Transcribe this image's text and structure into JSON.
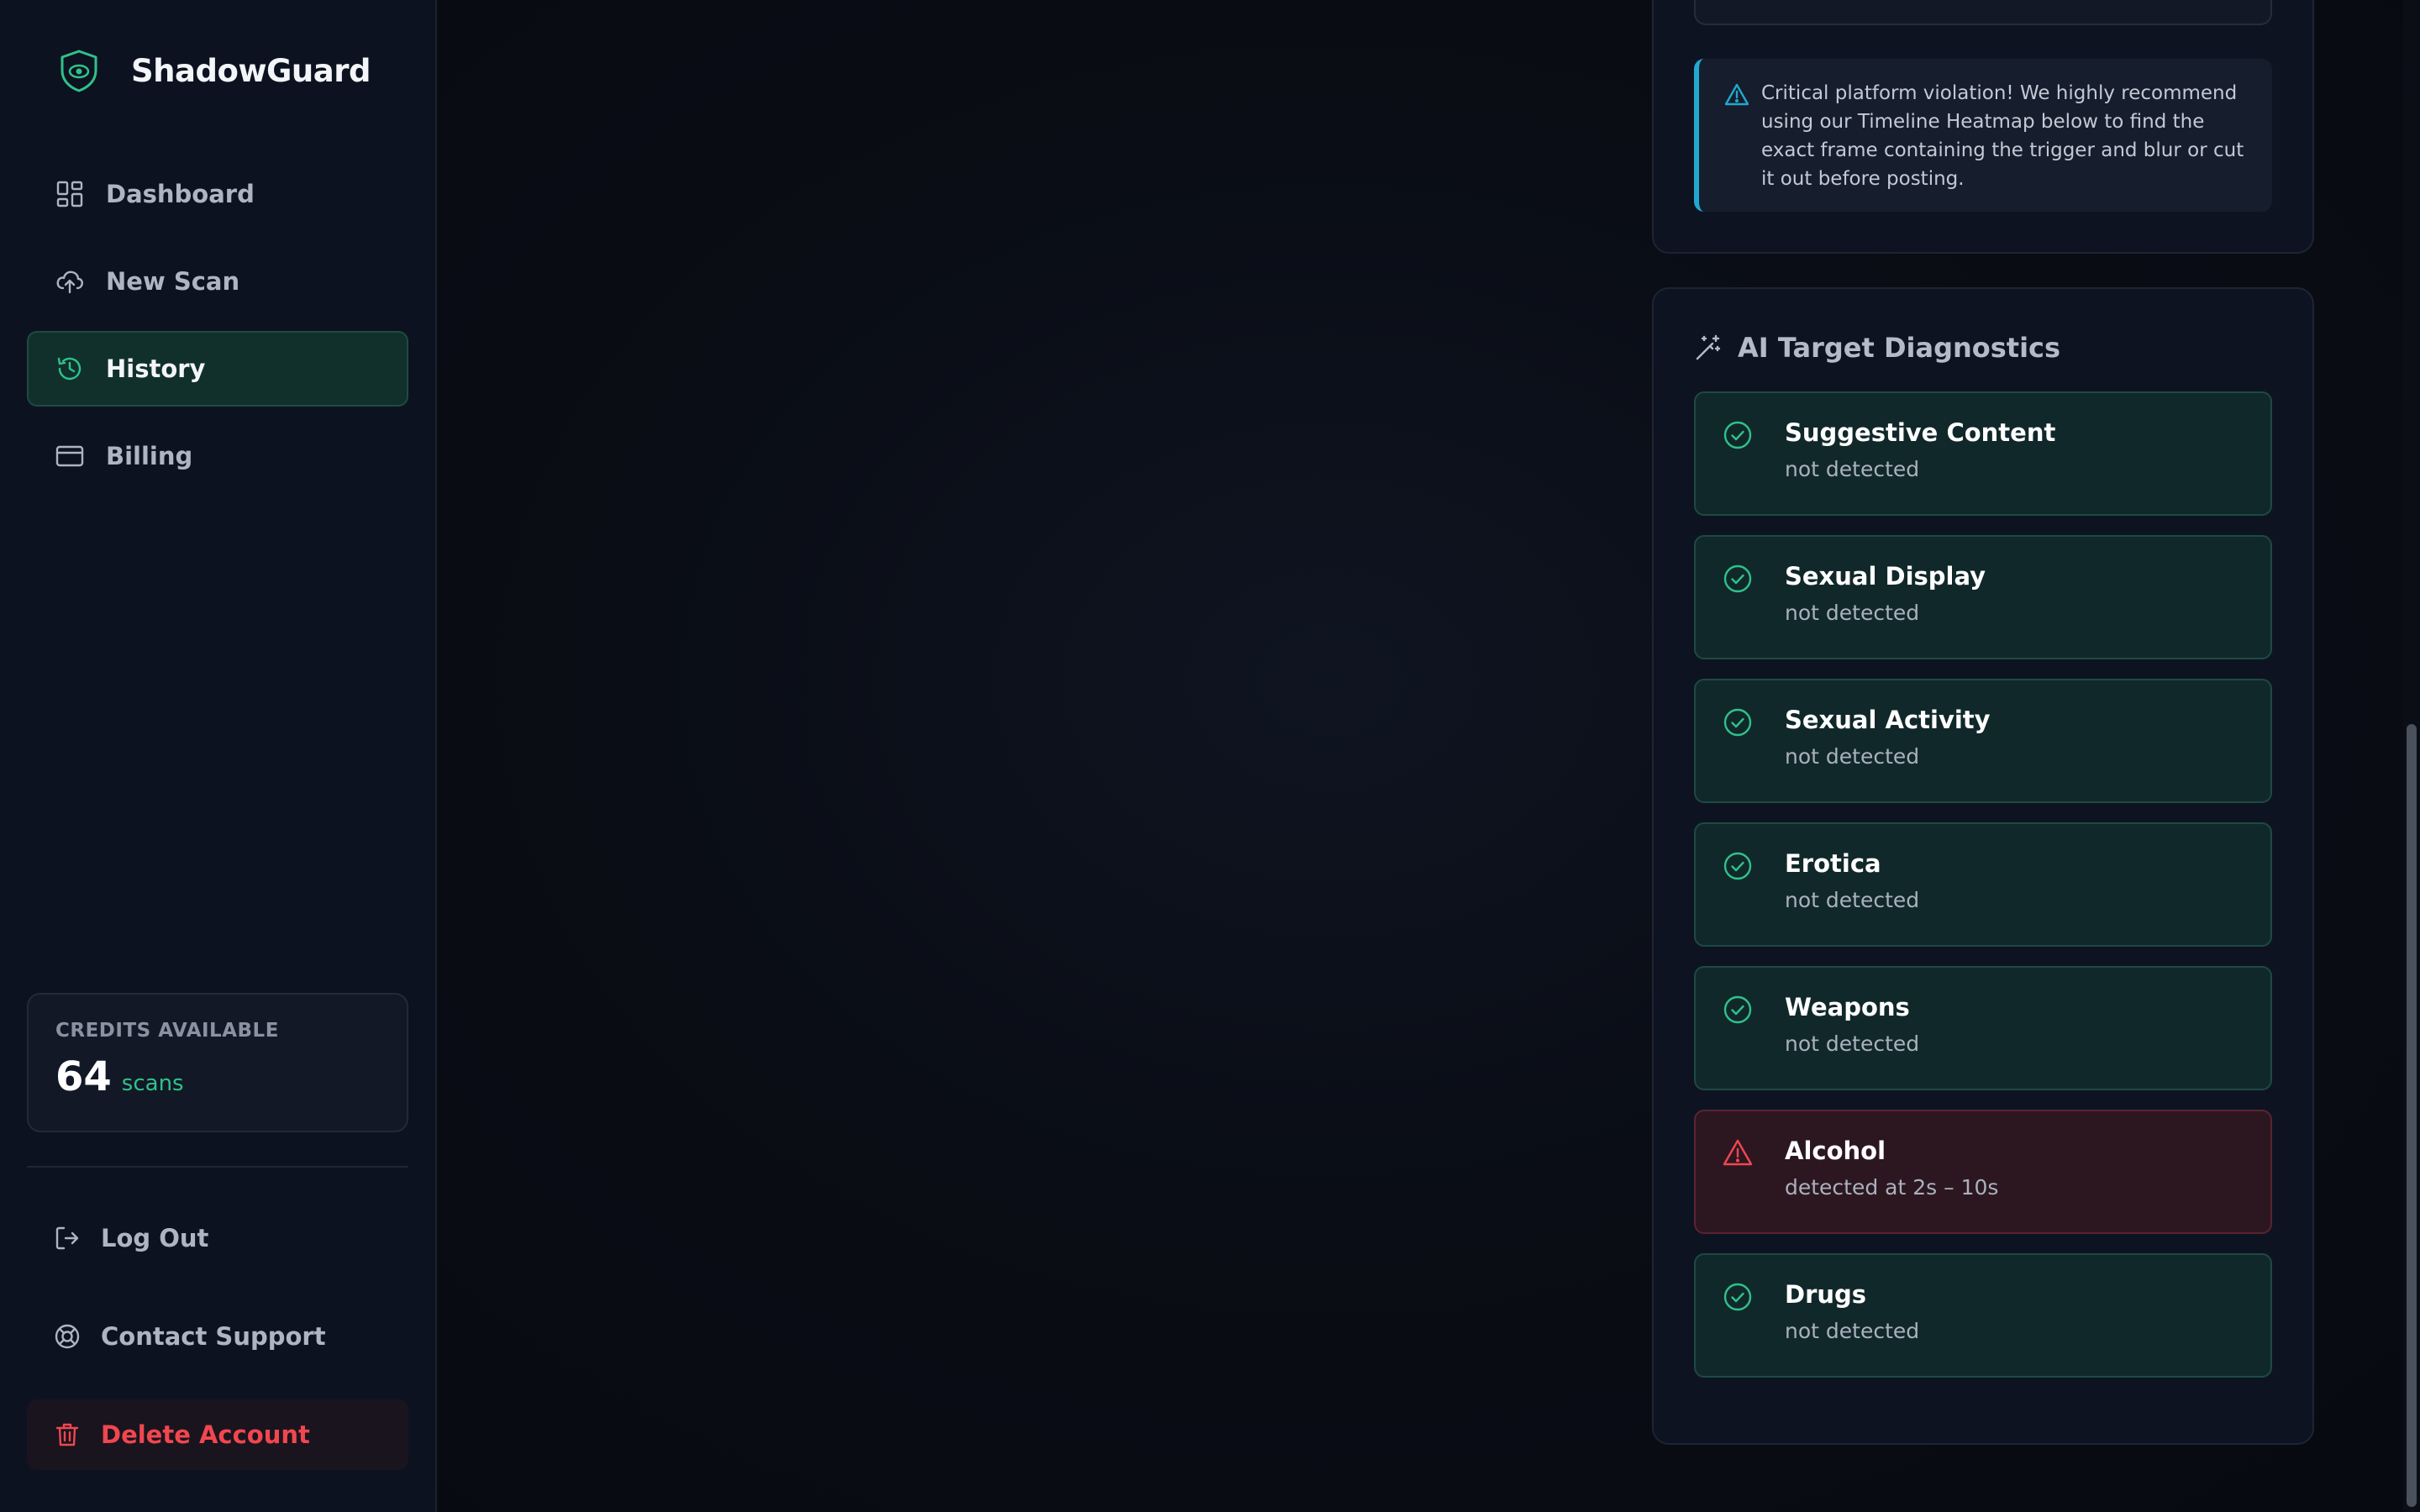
{
  "brand": {
    "name": "ShadowGuard"
  },
  "nav": [
    {
      "label": "Dashboard",
      "icon": "dashboard-grid-icon"
    },
    {
      "label": "New Scan",
      "icon": "cloud-upload-icon"
    },
    {
      "label": "History",
      "icon": "history-icon",
      "active": true
    },
    {
      "label": "Billing",
      "icon": "credit-card-icon"
    }
  ],
  "credits": {
    "title": "CREDITS AVAILABLE",
    "value": "64",
    "unit": "scans"
  },
  "bottom_nav": {
    "logout": "Log Out",
    "support": "Contact Support",
    "delete": "Delete Account"
  },
  "alert": {
    "text": "Critical platform violation! We highly recommend using our Timeline Heatmap below to find the exact frame containing the trigger and blur or cut it out before posting."
  },
  "diagnostics": {
    "title": "AI Target Diagnostics",
    "items": [
      {
        "name": "Suggestive Content",
        "status": "not detected",
        "detected": false
      },
      {
        "name": "Sexual Display",
        "status": "not detected",
        "detected": false
      },
      {
        "name": "Sexual Activity",
        "status": "not detected",
        "detected": false
      },
      {
        "name": "Erotica",
        "status": "not detected",
        "detected": false
      },
      {
        "name": "Weapons",
        "status": "not detected",
        "detected": false
      },
      {
        "name": "Alcohol",
        "status": "detected at 2s – 10s",
        "detected": true
      },
      {
        "name": "Drugs",
        "status": "not detected",
        "detected": false
      }
    ]
  },
  "colors": {
    "accent_green": "#2fc28a",
    "danger_red": "#f0474f",
    "info_cyan": "#22a8cf"
  }
}
